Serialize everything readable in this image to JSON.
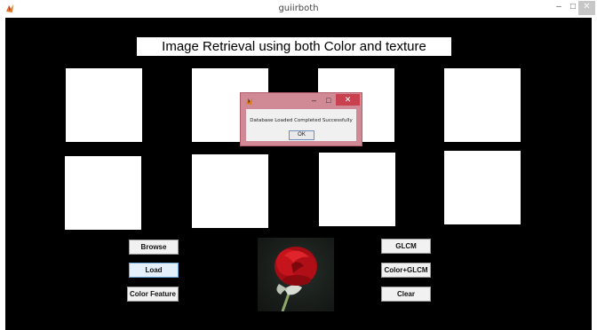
{
  "window": {
    "title": "guiirboth",
    "minimize_glyph": "–",
    "maximize_glyph": "□",
    "close_glyph": "✕"
  },
  "main": {
    "heading": "Image Retrieval using both Color and texture"
  },
  "buttons": {
    "browse": "Browse",
    "load": "Load",
    "color_feature": "Color Feature",
    "glcm": "GLCM",
    "color_glcm": "Color+GLCM",
    "clear": "Clear"
  },
  "dialog": {
    "message": "Database Loaded Completed Successfully",
    "ok_label": "OK",
    "minimize_glyph": "–",
    "maximize_glyph": "□",
    "close_glyph": "✕"
  },
  "colors": {
    "canvas_bg": "#000000",
    "dialog_frame": "#d08a96",
    "dialog_close": "#c9414f",
    "load_active": "#e3effa"
  }
}
